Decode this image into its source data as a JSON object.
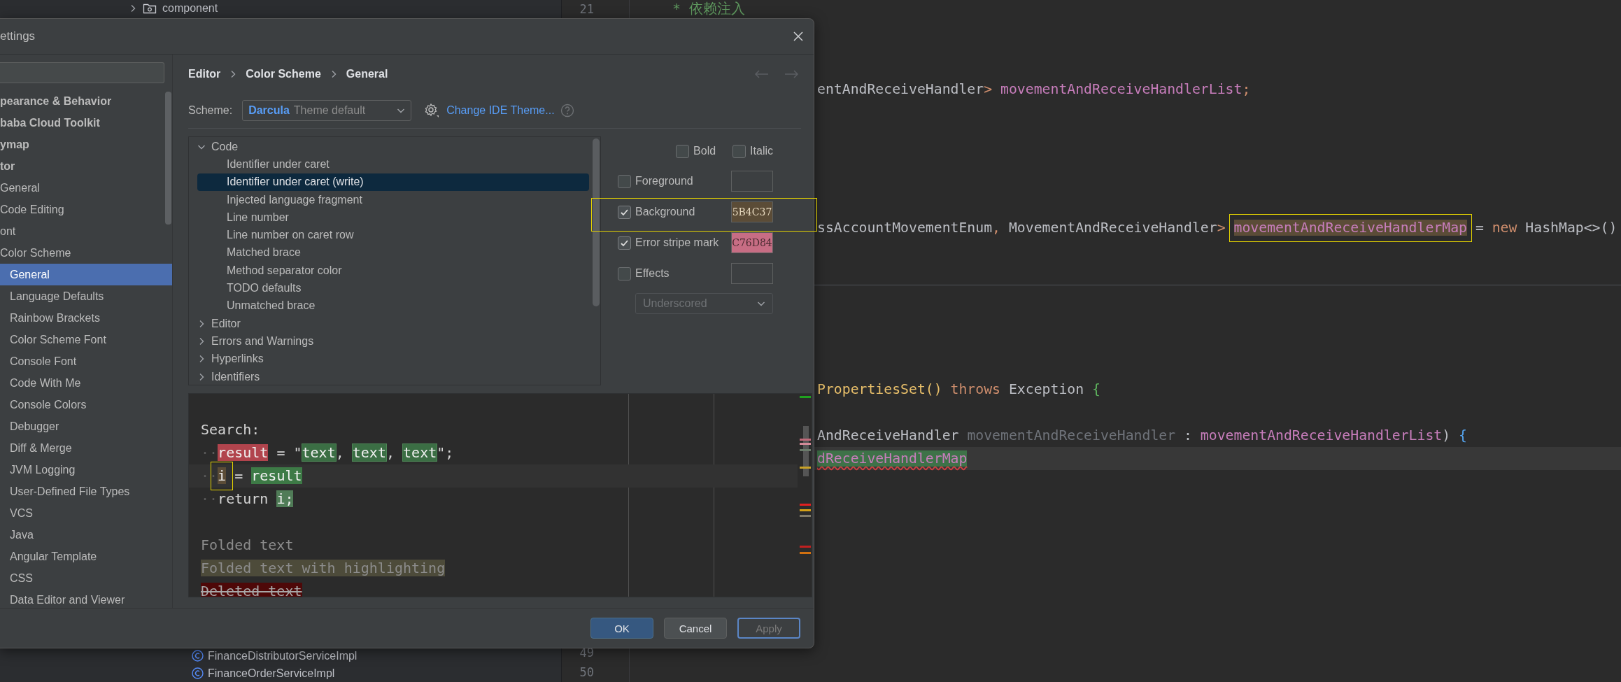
{
  "project_panel": {
    "folder": {
      "label": "component",
      "expanded": false
    },
    "classes": [
      {
        "label": "FinanceDistributorServiceImpl"
      },
      {
        "label": "FinanceOrderServiceImpl"
      }
    ]
  },
  "editor": {
    "top_line_number": "21",
    "top_comment": "* 依赖注入",
    "bottom_line_numbers": [
      "49",
      "50"
    ],
    "lines": [
      {
        "kind": "blank"
      },
      {
        "kind": "blank"
      },
      {
        "kind": "code",
        "caret_row": false,
        "tokens": [
          {
            "text": "entAndReceiveHandler",
            "kind": "plain"
          },
          {
            "text": "> ",
            "kind": "punct"
          },
          {
            "text": "movementAndReceiveHandlerList",
            "kind": "field"
          },
          {
            "text": ";",
            "kind": "punct"
          }
        ]
      },
      {
        "kind": "blank"
      },
      {
        "kind": "blank"
      },
      {
        "kind": "blank"
      },
      {
        "kind": "blank"
      },
      {
        "kind": "blank"
      },
      {
        "kind": "code",
        "caret_row": false,
        "tokens": [
          {
            "text": "ssAccountMovementEnum",
            "kind": "plain"
          },
          {
            "text": ", ",
            "kind": "punct"
          },
          {
            "text": "MovementAndReceiveHandler",
            "kind": "plain"
          },
          {
            "text": "> ",
            "kind": "punct"
          },
          {
            "text": "movementAndReceiveHandlerMap",
            "kind": "field_write",
            "annotated": true,
            "warning": false
          },
          {
            "text": " = ",
            "kind": "plain"
          },
          {
            "text": "new",
            "kind": "keyword"
          },
          {
            "text": " HashMap<>()",
            "kind": "plain"
          }
        ]
      },
      {
        "kind": "blank"
      },
      {
        "kind": "separator"
      },
      {
        "kind": "blank"
      },
      {
        "kind": "blank"
      },
      {
        "kind": "blank"
      },
      {
        "kind": "blank"
      },
      {
        "kind": "code",
        "caret_row": false,
        "tokens": [
          {
            "text": "PropertiesSet()",
            "kind": "method"
          },
          {
            "text": " throws",
            "kind": "keyword"
          },
          {
            "text": " Exception ",
            "kind": "plain"
          },
          {
            "text": "{",
            "kind": "brace_green"
          }
        ]
      },
      {
        "kind": "blank"
      },
      {
        "kind": "code",
        "caret_row": false,
        "tokens": [
          {
            "text": "AndReceiveHandler",
            "kind": "plain"
          },
          {
            "text": " movementAndReceiveHandler",
            "kind": "unused"
          },
          {
            "text": " : ",
            "kind": "plain"
          },
          {
            "text": "movementAndReceiveHandlerList",
            "kind": "field"
          },
          {
            "text": ") ",
            "kind": "plain"
          },
          {
            "text": "{",
            "kind": "brace_blue"
          }
        ]
      },
      {
        "kind": "code",
        "caret_row": true,
        "tokens": [
          {
            "text": "dReceiveHandlerMap",
            "kind": "field_read",
            "annotated": false,
            "warning": true
          }
        ]
      }
    ]
  },
  "dialog": {
    "title": "ettings",
    "sidebar": {
      "items": [
        {
          "label": "pearance & Behavior",
          "selected": false
        },
        {
          "label": "baba Cloud Toolkit",
          "selected": false
        },
        {
          "label": "ymap",
          "selected": false
        },
        {
          "label": "tor",
          "selected": false,
          "children": [
            {
              "label": "General",
              "selected": false
            },
            {
              "label": "Code Editing",
              "selected": false
            },
            {
              "label": "ont",
              "selected": false
            },
            {
              "label": "Color Scheme",
              "selected": false,
              "children": [
                {
                  "label": "General",
                  "selected": true
                },
                {
                  "label": "Language Defaults",
                  "selected": false
                },
                {
                  "label": "Rainbow Brackets",
                  "selected": false
                },
                {
                  "label": "Color Scheme Font",
                  "selected": false
                },
                {
                  "label": "Console Font",
                  "selected": false
                },
                {
                  "label": "Code With Me",
                  "selected": false
                },
                {
                  "label": "Console Colors",
                  "selected": false
                },
                {
                  "label": "Debugger",
                  "selected": false
                },
                {
                  "label": "Diff & Merge",
                  "selected": false
                },
                {
                  "label": "JVM Logging",
                  "selected": false
                },
                {
                  "label": "User-Defined File Types",
                  "selected": false
                },
                {
                  "label": "VCS",
                  "selected": false
                },
                {
                  "label": "Java",
                  "selected": false
                },
                {
                  "label": "Angular Template",
                  "selected": false
                },
                {
                  "label": "CSS",
                  "selected": false
                },
                {
                  "label": "Data Editor and Viewer",
                  "selected": false
                }
              ]
            }
          ]
        }
      ]
    },
    "breadcrumb": [
      "Editor",
      "Color Scheme",
      "General"
    ],
    "scheme": {
      "label": "Scheme:",
      "name": "Darcula",
      "note": "Theme default"
    },
    "theme_link": "Change IDE Theme...",
    "tree": [
      {
        "label": "Code",
        "expanded": true,
        "selected": false,
        "children": [
          {
            "label": "Identifier under caret",
            "selected": false
          },
          {
            "label": "Identifier under caret (write)",
            "selected": true
          },
          {
            "label": "Injected language fragment",
            "selected": false
          },
          {
            "label": "Line number",
            "selected": false
          },
          {
            "label": "Line number on caret row",
            "selected": false
          },
          {
            "label": "Matched brace",
            "selected": false
          },
          {
            "label": "Method separator color",
            "selected": false
          },
          {
            "label": "TODO defaults",
            "selected": false
          },
          {
            "label": "Unmatched brace",
            "selected": false
          }
        ]
      },
      {
        "label": "Editor",
        "expanded": false,
        "selected": false
      },
      {
        "label": "Errors and Warnings",
        "expanded": false,
        "selected": false
      },
      {
        "label": "Hyperlinks",
        "expanded": false,
        "selected": false
      },
      {
        "label": "Identifiers",
        "expanded": false,
        "selected": false
      }
    ],
    "font_style": [
      {
        "label": "Bold",
        "checked": false
      },
      {
        "label": "Italic",
        "checked": false
      }
    ],
    "attributes": [
      {
        "label": "Foreground",
        "checked": false,
        "annotated": false
      },
      {
        "label": "Background",
        "checked": true,
        "value": "5B4C37",
        "color": "#5b4c37",
        "annotated": true
      },
      {
        "label": "Error stripe mark",
        "checked": true,
        "value": "C76D84",
        "color": "#c76d84",
        "annotated": false
      },
      {
        "label": "Effects",
        "checked": false,
        "annotated": false
      }
    ],
    "effect_type": {
      "value": "Underscored",
      "disabled": true
    },
    "preview": {
      "lines": [
        {
          "kind": "code",
          "caret_row": false,
          "tokens": [
            {
              "text": "Search:",
              "kind": "plain"
            }
          ]
        },
        {
          "kind": "code",
          "caret_row": false,
          "tokens": [
            {
              "text": "··",
              "kind": "whitespace"
            },
            {
              "text": "result",
              "kind": "search_write"
            },
            {
              "text": " = \"",
              "kind": "plain"
            },
            {
              "text": "text",
              "kind": "search"
            },
            {
              "text": ", ",
              "kind": "plain"
            },
            {
              "text": "text",
              "kind": "search"
            },
            {
              "text": ", ",
              "kind": "plain"
            },
            {
              "text": "text",
              "kind": "search"
            },
            {
              "text": "\";",
              "kind": "plain"
            }
          ]
        },
        {
          "kind": "code",
          "caret_row": true,
          "tokens": [
            {
              "text": "··",
              "kind": "whitespace"
            },
            {
              "text": "i",
              "kind": "caret_write",
              "annotated": true
            },
            {
              "text": " = ",
              "kind": "plain"
            },
            {
              "text": "result",
              "kind": "caret_read",
              "annotated": false
            }
          ]
        },
        {
          "kind": "code",
          "caret_row": false,
          "tokens": [
            {
              "text": "··",
              "kind": "whitespace"
            },
            {
              "text": "return ",
              "kind": "plain"
            },
            {
              "text": "i;",
              "kind": "read_usage"
            }
          ]
        },
        {
          "kind": "blank"
        },
        {
          "kind": "code",
          "caret_row": false,
          "tokens": [
            {
              "text": "Folded text",
              "kind": "folded"
            }
          ]
        },
        {
          "kind": "code",
          "caret_row": false,
          "tokens": [
            {
              "text": "Folded text with highlighting",
              "kind": "folded_highlight"
            }
          ]
        },
        {
          "kind": "code",
          "caret_row": false,
          "tokens": [
            {
              "text": "Deleted text",
              "kind": "deleted"
            }
          ]
        }
      ]
    },
    "buttons": [
      {
        "label": "OK",
        "kind": "primary",
        "disabled": false
      },
      {
        "label": "Cancel",
        "kind": "secondary",
        "disabled": false
      },
      {
        "label": "Apply",
        "kind": "focused",
        "disabled": true
      }
    ]
  }
}
